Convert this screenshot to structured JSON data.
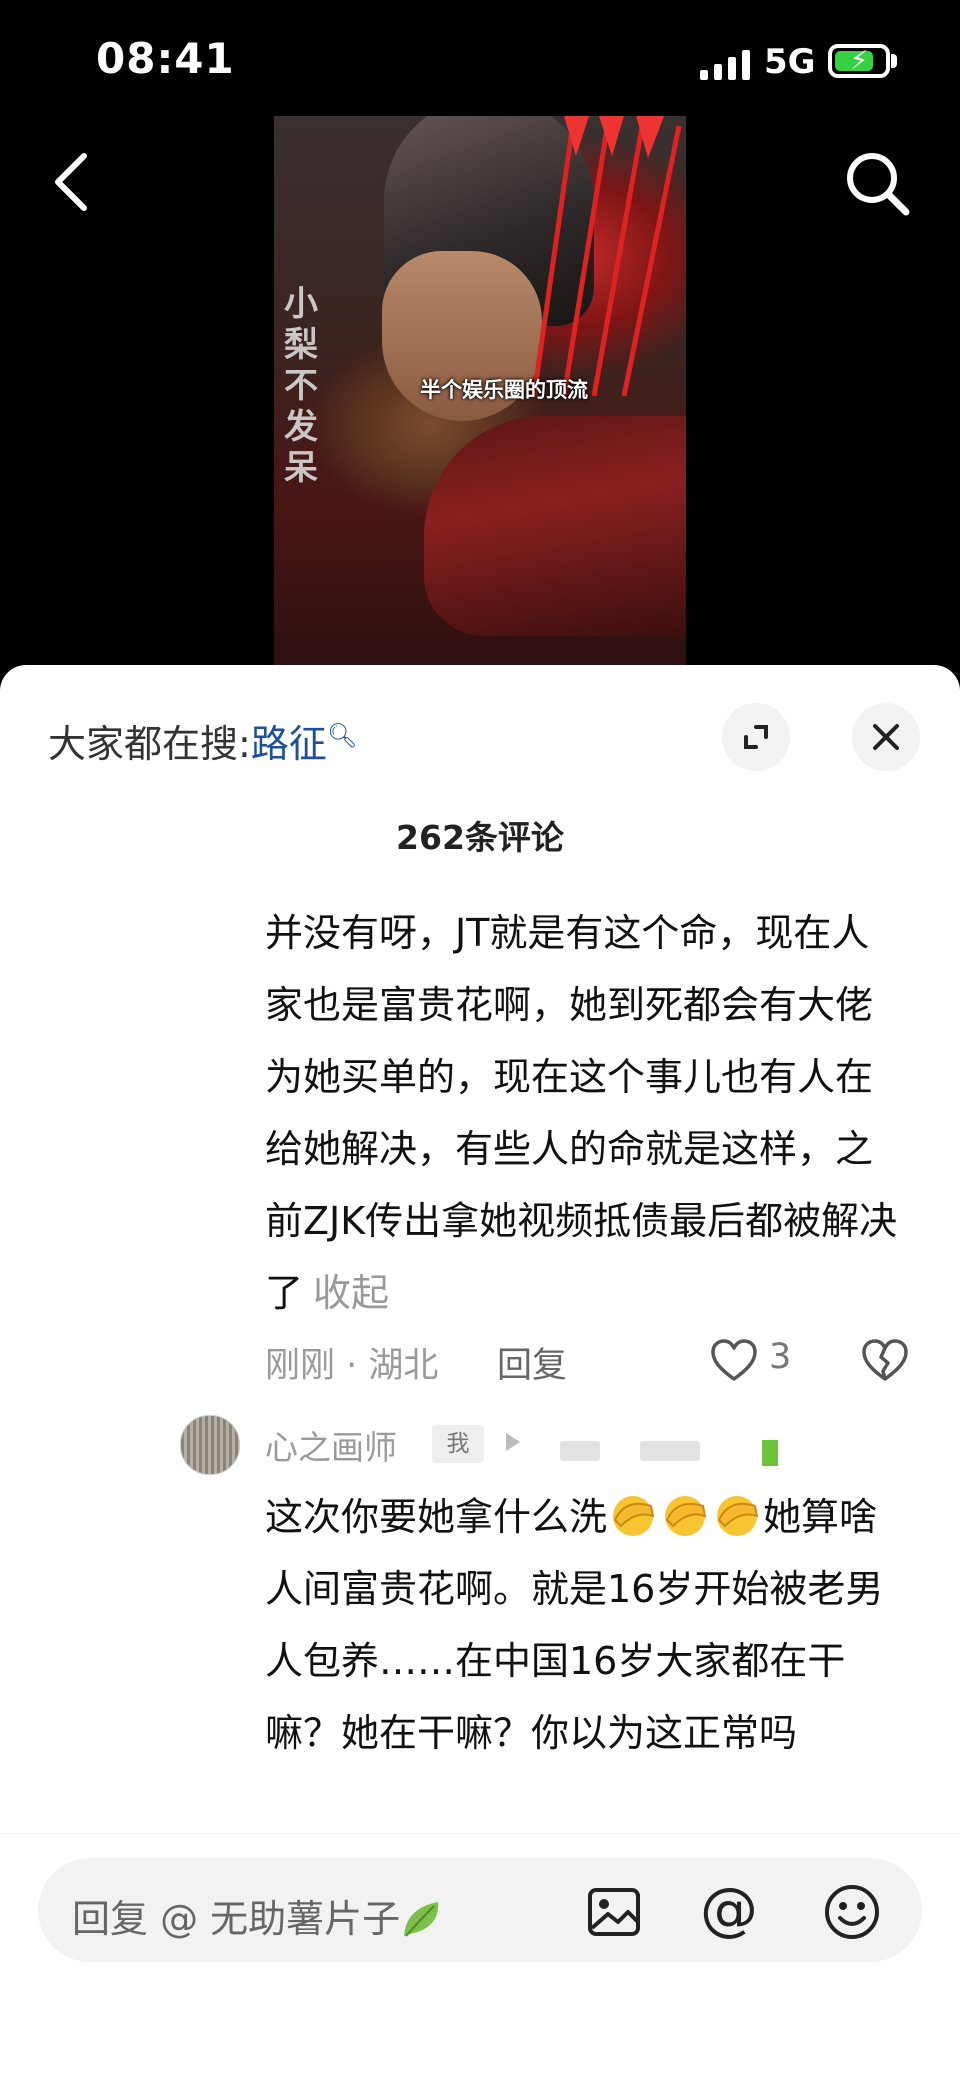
{
  "status_bar": {
    "time": "08:41",
    "network": "5G"
  },
  "video": {
    "watermark": "小梨不发呆",
    "caption": "半个娱乐圈的顶流"
  },
  "hot_search": {
    "prefix": "大家都在搜:",
    "keyword": "路征"
  },
  "comment_count_label": "262条评论",
  "comment": {
    "text": "并没有呀，JT就是有这个命，现在人家也是富贵花啊，她到死都会有大佬为她买单的，现在这个事儿也有人在给她解决，有些人的命就是这样，之前ZJK传出拿她视频抵债最后都被解决了",
    "collapse_label": "收起",
    "time_location": "刚刚 · 湖北",
    "reply_label": "回复",
    "like_count": "3"
  },
  "reply": {
    "username": "心之画师",
    "badge": "我",
    "text_part1": "这次你要她拿什么洗",
    "text_part2": "她算啥人间富贵花啊。就是16岁开始被老男人包养……在中国16岁大家都在干嘛？她在干嘛？你以为这正常吗"
  },
  "input_bar": {
    "placeholder": "回复 @ 无助薯片子"
  },
  "icons": {
    "back": "back-arrow-icon",
    "search": "search-icon",
    "expand": "expand-icon",
    "close": "close-icon",
    "like": "heart-icon",
    "dislike": "broken-heart-icon",
    "image": "image-icon",
    "at": "at-icon",
    "emoji": "smiley-icon"
  },
  "colors": {
    "accent_link": "#1d4f9a",
    "battery": "#36d043"
  }
}
